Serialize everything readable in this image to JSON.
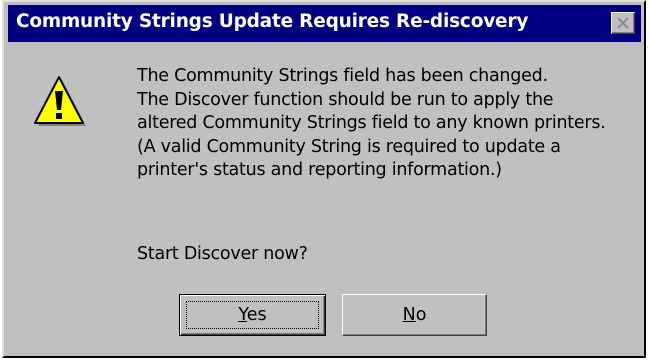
{
  "dialog": {
    "title": "Community Strings Update Requires Re-discovery",
    "message_lines": [
      "The Community Strings field has been changed.",
      "The Discover function should be run to apply the",
      "altered Community Strings field to any known printers.",
      "(A valid Community String is required to update a",
      "printer's status and reporting information.)"
    ],
    "prompt": "Start Discover now?",
    "buttons": {
      "yes": {
        "mnemonic": "Y",
        "rest": "es"
      },
      "no": {
        "mnemonic": "N",
        "rest": "o"
      }
    },
    "icons": {
      "message_icon": "warning-icon",
      "close": "close-icon"
    },
    "colors": {
      "titlebar": "#000080",
      "face": "#c0c0c0",
      "warning_fill": "#ffff00"
    }
  }
}
